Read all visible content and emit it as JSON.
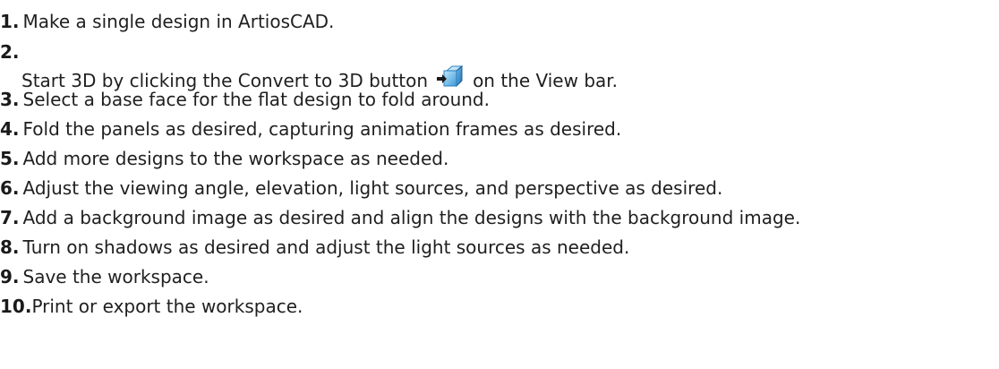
{
  "steps": [
    {
      "num": "1.",
      "text": "Make a single design in ArtiosCAD."
    },
    {
      "num": "2.",
      "text_before": "Start 3D by clicking the Convert to 3D button",
      "icon": "convert-to-3d-icon",
      "text_after": "on the View bar."
    },
    {
      "num": "3.",
      "text": "Select a base face for the flat design to fold around."
    },
    {
      "num": "4.",
      "text": "Fold the panels as desired, capturing animation frames as desired."
    },
    {
      "num": "5.",
      "text": "Add more designs to the workspace as needed."
    },
    {
      "num": "6.",
      "text": "Adjust the viewing angle, elevation, light sources, and perspective as desired."
    },
    {
      "num": "7.",
      "text": "Add a background image as desired and align the designs with the background image."
    },
    {
      "num": "8.",
      "text": "Turn on shadows as desired and adjust the light sources as needed."
    },
    {
      "num": "9.",
      "text": "Save the workspace."
    },
    {
      "num": "10.",
      "text": "Print or export the workspace."
    }
  ]
}
